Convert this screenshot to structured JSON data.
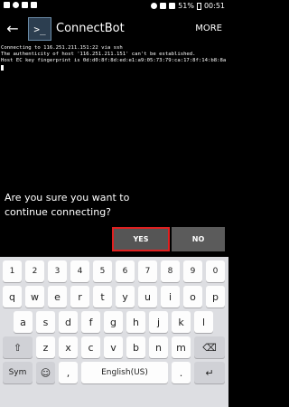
{
  "status_bar": {
    "battery": "51%",
    "time": "00:51"
  },
  "app_bar": {
    "back_label": "←",
    "icon_label": ">_",
    "title": "ConnectBot",
    "more_label": "MORE"
  },
  "terminal": {
    "lines": [
      "Connecting to 116.251.211.151:22 via ssh",
      "The authenticity of host '116.251.211.151' can't be established.",
      "Host EC key fingerprint is 0d:d0:8f:8d:ed:e1:a9:05:73:79:ca:17:8f:14:b8:8a"
    ]
  },
  "dialog": {
    "question": "Are you sure you want to continue connecting?",
    "yes_label": "YES",
    "no_label": "NO"
  },
  "keyboard": {
    "numbers": [
      "1",
      "2",
      "3",
      "4",
      "5",
      "6",
      "7",
      "8",
      "9",
      "0"
    ],
    "row1": [
      "q",
      "w",
      "e",
      "r",
      "t",
      "y",
      "u",
      "i",
      "o",
      "p"
    ],
    "row2": [
      "a",
      "s",
      "d",
      "f",
      "g",
      "h",
      "j",
      "k",
      "l"
    ],
    "row3": [
      "z",
      "x",
      "c",
      "v",
      "b",
      "n",
      "m"
    ],
    "shift_label": "⇧",
    "backspace_label": "⌫",
    "sym_label": "Sym",
    "emoji_label": "☺",
    "comma_label": ",",
    "space_label": "English(US)",
    "period_label": ".",
    "enter_label": "↵"
  }
}
